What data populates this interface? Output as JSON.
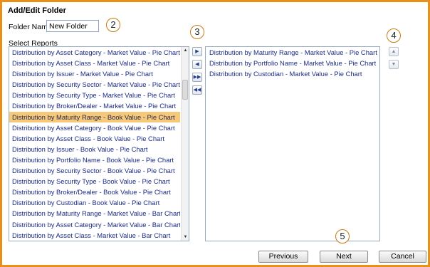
{
  "dialog": {
    "title": "Add/Edit Folder"
  },
  "folder": {
    "label": "Folder Name:",
    "value": "New Folder"
  },
  "select_reports_label": "Select Reports",
  "available_reports": [
    "Distribution by Asset Category - Market Value - Pie Chart",
    "Distribution by Asset Class - Market Value - Pie Chart",
    "Distribution by Issuer - Market Value - Pie Chart",
    "Distribution by Security Sector - Market Value - Pie Chart",
    "Distribution by Security Type - Market Value - Pie Chart",
    "Distribution by Broker/Dealer - Market Value - Pie Chart",
    "Distribution by Maturity Range - Book Value - Pie Chart",
    "Distribution by Asset Category - Book Value - Pie Chart",
    "Distribution by Asset Class - Book Value - Pie Chart",
    "Distribution by Issuer - Book Value - Pie Chart",
    "Distribution by Portfolio Name - Book Value - Pie Chart",
    "Distribution by Security Sector - Book Value - Pie Chart",
    "Distribution by Security Type - Book Value - Pie Chart",
    "Distribution by Broker/Dealer - Book Value - Pie Chart",
    "Distribution by Custodian - Book Value - Pie Chart",
    "Distribution by Maturity Range - Market Value - Bar Chart",
    "Distribution by Asset Category - Market Value - Bar Chart",
    "Distribution by Asset Class - Market Value - Bar Chart"
  ],
  "selected_available_index": 6,
  "selected_reports": [
    "Distribution by Maturity Range - Market Value - Pie Chart",
    "Distribution by Portfolio Name - Market Value - Pie Chart",
    "Distribution by Custodian - Market Value - Pie Chart"
  ],
  "move_buttons": {
    "add_one": "▶",
    "remove_one": "◀",
    "add_all": "▶▶",
    "remove_all": "◀◀"
  },
  "order_buttons": {
    "up": "▲",
    "down": "▼"
  },
  "callouts": {
    "folder_name": "2",
    "move": "3",
    "order": "4",
    "next": "5"
  },
  "buttons": {
    "previous": "Previous",
    "next": "Next",
    "cancel": "Cancel"
  },
  "colors": {
    "frame_border": "#e8901c",
    "selected_row": "#f6c879",
    "list_text": "#1c2c86"
  }
}
